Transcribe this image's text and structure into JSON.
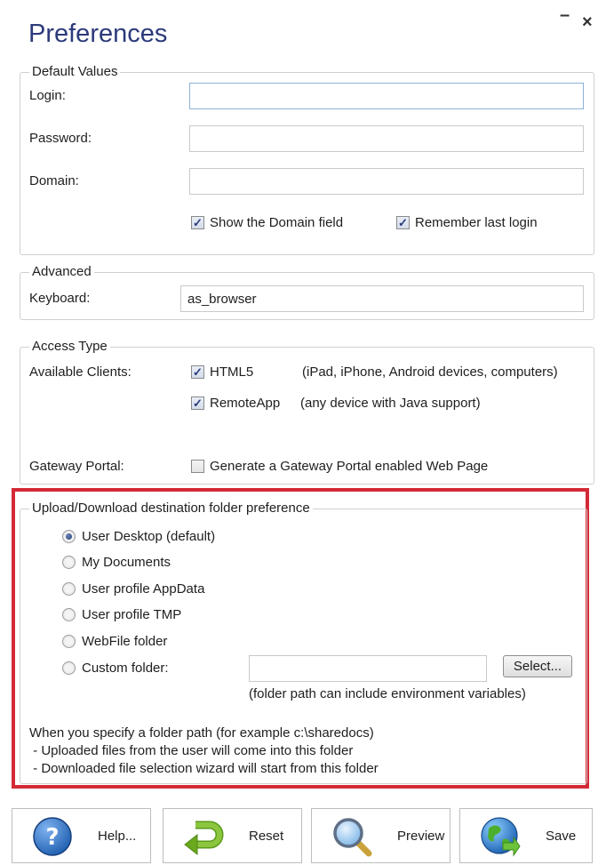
{
  "window": {
    "title": "Preferences",
    "minimize_glyph": "–",
    "close_glyph": "×"
  },
  "default_values": {
    "legend": "Default Values",
    "login_label": "Login:",
    "login_value": "",
    "password_label": "Password:",
    "password_value": "",
    "domain_label": "Domain:",
    "domain_value": "",
    "show_domain_label": "Show the Domain field",
    "show_domain_checked": true,
    "remember_login_label": "Remember last login",
    "remember_login_checked": true
  },
  "advanced": {
    "legend": "Advanced",
    "keyboard_label": "Keyboard:",
    "keyboard_value": "as_browser"
  },
  "access_type": {
    "legend": "Access Type",
    "available_clients_label": "Available Clients:",
    "html5_label": "HTML5",
    "html5_checked": true,
    "html5_desc": "(iPad, iPhone, Android devices, computers)",
    "remoteapp_label": "RemoteApp",
    "remoteapp_checked": true,
    "remoteapp_desc": "(any device with Java support)",
    "gateway_portal_label": "Gateway Portal:",
    "gateway_portal_option": "Generate a Gateway Portal enabled Web Page",
    "gateway_portal_checked": false
  },
  "upload_download": {
    "legend": "Upload/Download destination folder preference",
    "options": [
      "User Desktop (default)",
      "My Documents",
      "User profile AppData",
      "User profile TMP",
      "WebFile folder",
      "Custom folder:"
    ],
    "selected_option": "User Desktop (default)",
    "custom_folder_value": "",
    "select_button": "Select...",
    "folder_hint": "(folder path can include environment variables)",
    "info_line1": "When you specify a folder path (for example c:\\sharedocs)",
    "info_line2": " - Uploaded files from the user will come into this folder",
    "info_line3": " - Downloaded file selection wizard will start from this folder",
    "highlight_color": "#d42a36"
  },
  "buttons": {
    "help": {
      "label": "Help...",
      "icon": "help-icon"
    },
    "reset": {
      "label": "Reset",
      "icon": "reset-arrow-icon"
    },
    "preview": {
      "label": "Preview",
      "icon": "magnifier-icon"
    },
    "save": {
      "label": "Save",
      "icon": "globe-save-icon"
    }
  },
  "colors": {
    "title": "#2b3a7a",
    "accent_blue": "#1f63b8",
    "reset_green": "#6aa81e"
  }
}
